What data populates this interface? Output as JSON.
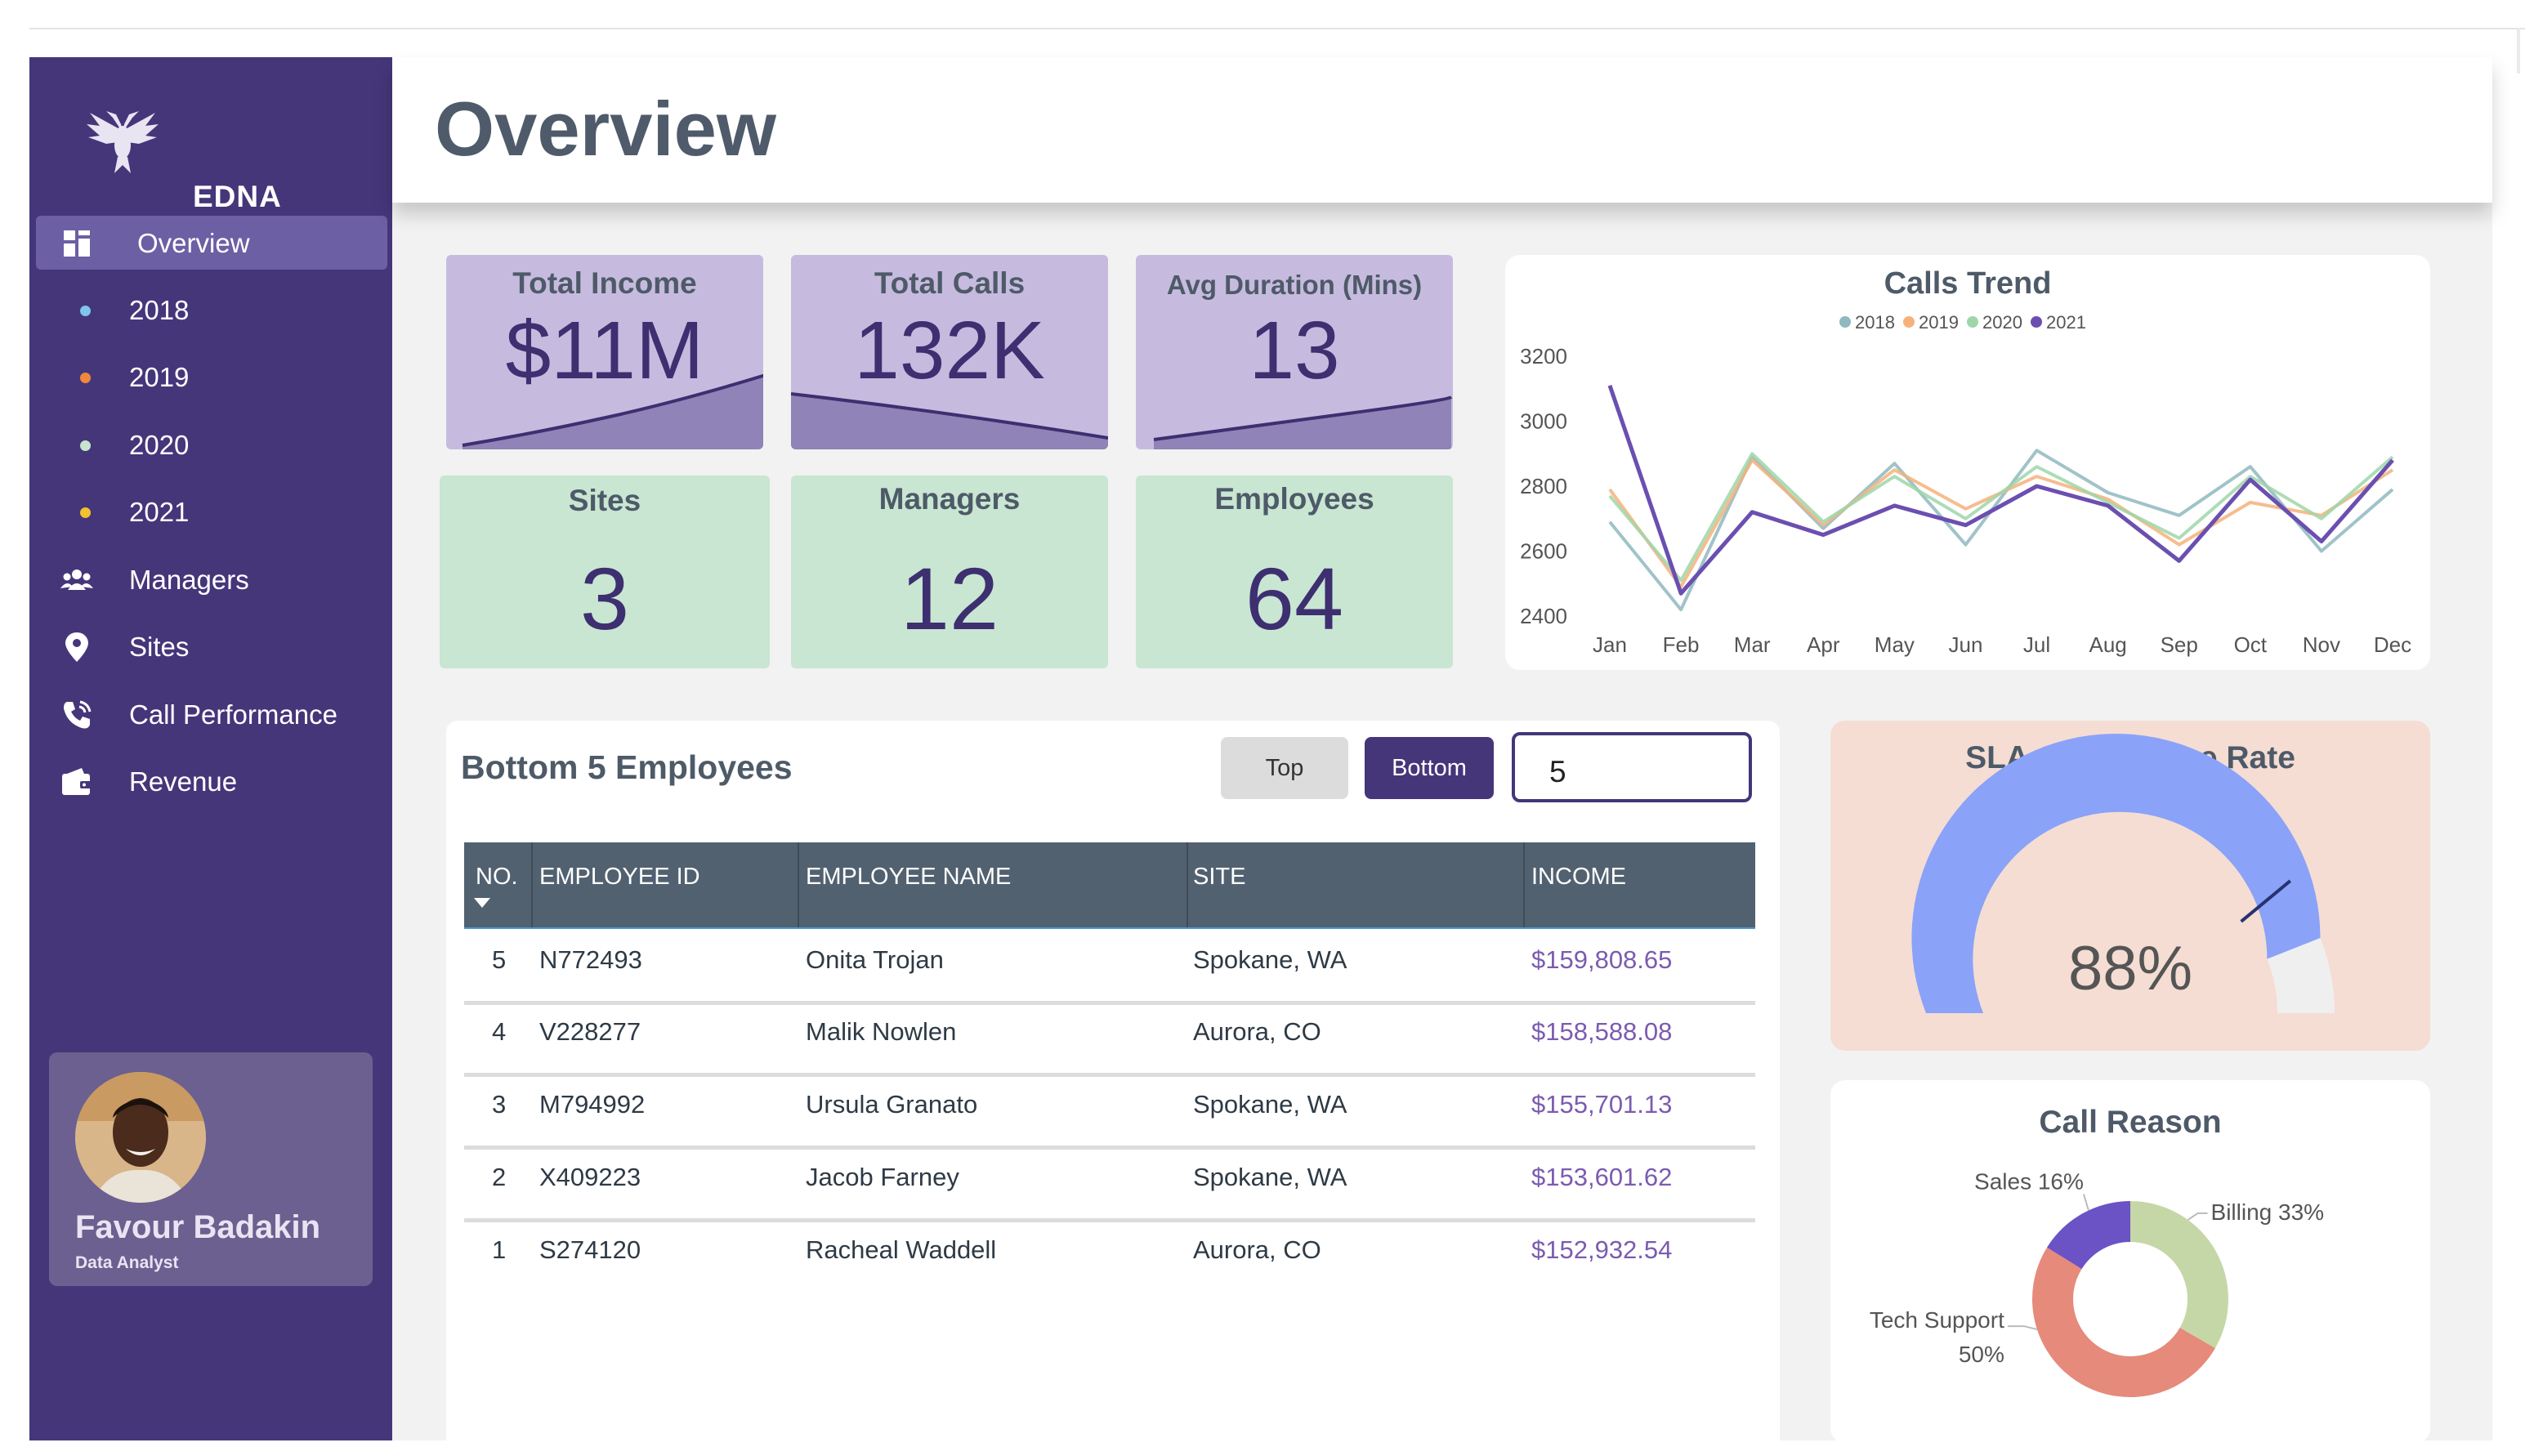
{
  "app": {
    "name": "EDNA"
  },
  "header": {
    "title": "Overview"
  },
  "sidebar": {
    "items": [
      {
        "label": "Overview",
        "icon": "dashboard-icon",
        "active": true
      },
      {
        "label": "2018",
        "icon": "dot",
        "color": "#7fc6e8"
      },
      {
        "label": "2019",
        "icon": "dot",
        "color": "#f0883b"
      },
      {
        "label": "2020",
        "icon": "dot",
        "color": "#c6e4cf"
      },
      {
        "label": "2021",
        "icon": "dot",
        "color": "#f2c230"
      },
      {
        "label": "Managers",
        "icon": "people-icon"
      },
      {
        "label": "Sites",
        "icon": "location-pin-icon"
      },
      {
        "label": "Call Performance",
        "icon": "phone-icon"
      },
      {
        "label": "Revenue",
        "icon": "wallet-icon"
      }
    ]
  },
  "profile": {
    "name": "Favour Badakin",
    "role": "Data Analyst"
  },
  "kpis": {
    "total_income": {
      "title": "Total Income",
      "value": "$11M"
    },
    "total_calls": {
      "title": "Total Calls",
      "value": "132K"
    },
    "avg_duration": {
      "title": "Avg Duration (Mins)",
      "value": "13"
    },
    "sites": {
      "title": "Sites",
      "value": "3"
    },
    "managers": {
      "title": "Managers",
      "value": "12"
    },
    "employees": {
      "title": "Employees",
      "value": "64"
    }
  },
  "employees_panel": {
    "title": "Bottom 5 Employees",
    "top_button": "Top",
    "bottom_button": "Bottom",
    "count_value": "5",
    "columns": [
      "NO.",
      "EMPLOYEE ID",
      "EMPLOYEE NAME",
      "SITE",
      "INCOME"
    ],
    "rows": [
      {
        "no": "5",
        "id": "N772493",
        "name": "Onita Trojan",
        "site": "Spokane, WA",
        "income": "$159,808.65"
      },
      {
        "no": "4",
        "id": "V228277",
        "name": "Malik Nowlen",
        "site": "Aurora, CO",
        "income": "$158,588.08"
      },
      {
        "no": "3",
        "id": "M794992",
        "name": "Ursula Granato",
        "site": "Spokane, WA",
        "income": "$155,701.13"
      },
      {
        "no": "2",
        "id": "X409223",
        "name": "Jacob Farney",
        "site": "Spokane, WA",
        "income": "$153,601.62"
      },
      {
        "no": "1",
        "id": "S274120",
        "name": "Racheal Waddell",
        "site": "Aurora, CO",
        "income": "$152,932.54"
      }
    ]
  },
  "sla": {
    "title": "SLA Compliance Rate",
    "value_label": "88%"
  },
  "chart_data": [
    {
      "type": "line",
      "title": "Calls Trend",
      "categories": [
        "Jan",
        "Feb",
        "Mar",
        "Apr",
        "May",
        "Jun",
        "Jul",
        "Aug",
        "Sep",
        "Oct",
        "Nov",
        "Dec"
      ],
      "ylim": [
        2400,
        3200
      ],
      "yticks": [
        2400,
        2600,
        2800,
        3000,
        3200
      ],
      "legend_position": "top",
      "grid": false,
      "series": [
        {
          "name": "2018",
          "color": "#8fb8bf",
          "values": [
            2690,
            2420,
            2890,
            2670,
            2870,
            2620,
            2910,
            2780,
            2710,
            2860,
            2600,
            2790
          ]
        },
        {
          "name": "2019",
          "color": "#f4b27a",
          "values": [
            2790,
            2490,
            2880,
            2680,
            2850,
            2730,
            2830,
            2760,
            2620,
            2750,
            2710,
            2850
          ]
        },
        {
          "name": "2020",
          "color": "#9fd6a9",
          "values": [
            2770,
            2510,
            2900,
            2690,
            2830,
            2700,
            2860,
            2750,
            2640,
            2830,
            2700,
            2890
          ]
        },
        {
          "name": "2021",
          "color": "#6b4fb0",
          "values": [
            3110,
            2470,
            2720,
            2650,
            2740,
            2680,
            2800,
            2740,
            2570,
            2820,
            2630,
            2880
          ]
        }
      ]
    },
    {
      "type": "gauge",
      "title": "SLA Compliance Rate",
      "value": 88,
      "max": 100,
      "target": 78,
      "colors": {
        "value": "#8aa2f8",
        "remainder": "#efefef",
        "target": "#273270"
      }
    },
    {
      "type": "pie",
      "title": "Call Reason",
      "slices": [
        {
          "label": "Billing",
          "value": 33,
          "text": "Billing 33%",
          "color": "#c6d7a7"
        },
        {
          "label": "Tech Support",
          "value": 50,
          "text_line1": "Tech Support",
          "text_line2": "50%",
          "color": "#e68a7b"
        },
        {
          "label": "Sales",
          "value": 16,
          "text": "Sales 16%",
          "color": "#6b52c5"
        }
      ]
    }
  ]
}
